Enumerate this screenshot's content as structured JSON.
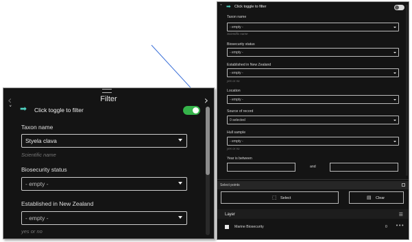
{
  "zoomed_panel": {
    "title": "Filter",
    "nav_prev_glyph": "‹",
    "nav_next_glyph": "›",
    "toggle_row": {
      "chevron_glyph": "˅",
      "arrow_glyph": "➡",
      "label": "Click toggle to filter",
      "toggle_on": true
    },
    "fields": [
      {
        "label": "Taxon name",
        "value": "Styela clava",
        "hint": "Scientific name"
      },
      {
        "label": "Biosecurity status",
        "value": "- empty -",
        "hint": ""
      },
      {
        "label": "Established in New Zealand",
        "value": "- empty -",
        "hint": "yes or no"
      }
    ]
  },
  "full_panel": {
    "toggle_row": {
      "chevron_glyph": "˅",
      "arrow_glyph": "➡",
      "label": "Click toggle to filter",
      "toggle_on": false
    },
    "fields": [
      {
        "label": "Taxon name",
        "value": "- empty -",
        "hint": "Scientific name"
      },
      {
        "label": "Biosecurity status",
        "value": "- empty -",
        "hint": ""
      },
      {
        "label": "Established in New Zealand",
        "value": "- empty -",
        "hint": "yes or no"
      },
      {
        "label": "Location",
        "value": "- empty -",
        "hint": ""
      },
      {
        "label": "Source of record",
        "value": "0 selected",
        "hint": ""
      },
      {
        "label": "Hull sample",
        "value": "- empty -",
        "hint": "yes or no"
      }
    ],
    "year_label": "Year is between",
    "year_and": "and",
    "select_points": {
      "header": "Select points",
      "select_label": "Select",
      "select_icon": "⬚",
      "clear_label": "Clear",
      "clear_icon": "▤"
    },
    "layer": {
      "header": "Layer",
      "filter_icon": "☰",
      "name": "Marine Biosecurity",
      "count": "0",
      "more_glyph": "•••"
    }
  },
  "colors": {
    "panel_bg": "#141414",
    "accent_teal": "#4fd1c0",
    "toggle_on": "#35b34a",
    "pointer_line": "#3a6fd8"
  }
}
